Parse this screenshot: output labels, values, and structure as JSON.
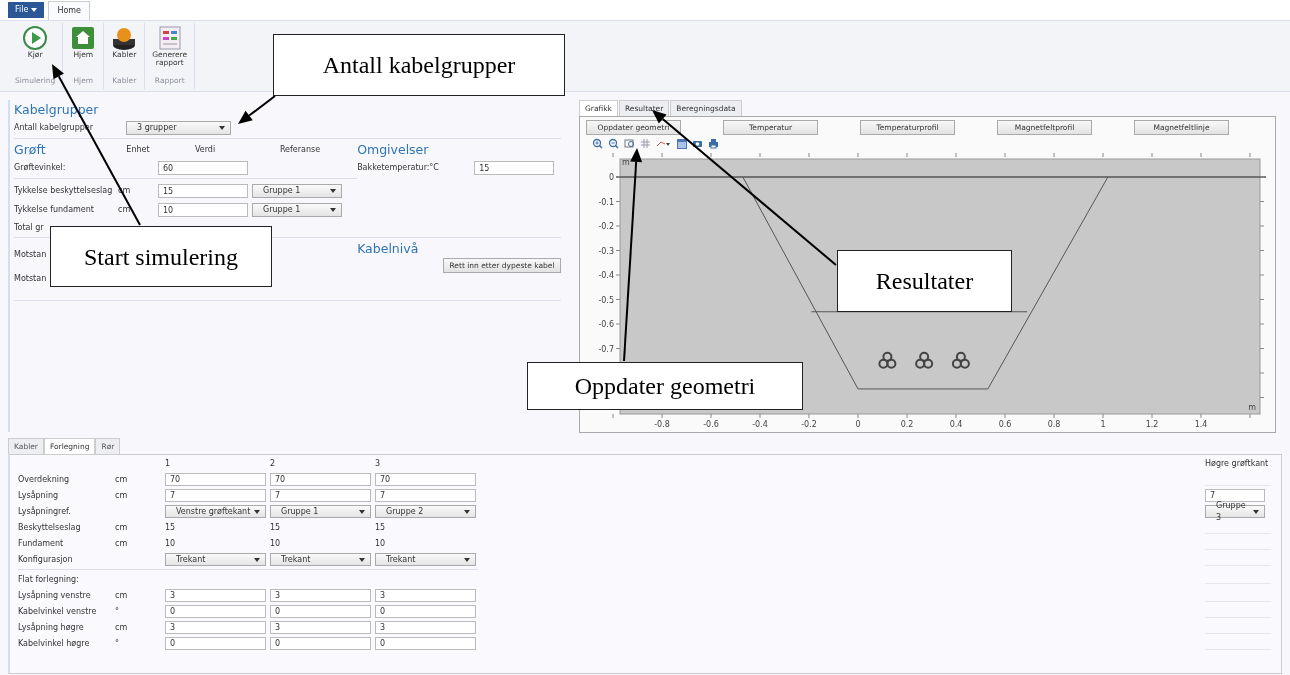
{
  "ribbon": {
    "file_menu": "File",
    "tabs": [
      {
        "label": "Home",
        "selected": true
      }
    ],
    "groups": [
      {
        "label": "Simulering",
        "buttons": [
          {
            "label": "Kjør",
            "kind": "play"
          }
        ]
      },
      {
        "label": "Hjem",
        "buttons": [
          {
            "label": "Hjem",
            "kind": "home"
          }
        ]
      },
      {
        "label": "Kabler",
        "buttons": [
          {
            "label": "Kabler",
            "kind": "cable"
          }
        ]
      },
      {
        "label": "Rapport",
        "buttons": [
          {
            "label": "Generere\nrapport",
            "kind": "report"
          }
        ]
      }
    ]
  },
  "kabelgrupper": {
    "title": "Kabelgrupper",
    "label": "Antall kabelgrupper",
    "value": "3 grupper"
  },
  "groft": {
    "title": "Grøft",
    "columns": [
      "Enhet",
      "Verdi",
      "Referanse"
    ],
    "rows": [
      {
        "label": "Grøftevinkel:",
        "value": "60"
      },
      {
        "label": "Tykkelse beskyttelseslag",
        "unit": "cm",
        "value": "15",
        "reference": "Gruppe 1"
      },
      {
        "label": "Tykkelse fundament",
        "unit": "cm",
        "value": "10",
        "reference": "Gruppe 1"
      },
      {
        "label": "Total gr"
      }
    ]
  },
  "omgivelser": {
    "title": "Omgivelser",
    "rows": [
      {
        "label": "Bakketemperatur:",
        "unit": "°C",
        "value": "15"
      }
    ]
  },
  "motstand": {
    "rows": [
      {
        "label": "Motstan"
      },
      {
        "label": "Motstan"
      }
    ]
  },
  "kabelniva": {
    "title": "Kabelnivå",
    "button": "Rett inn etter dypeste kabel"
  },
  "graphics": {
    "tabs": [
      {
        "label": "Grafikk",
        "selected": true
      },
      {
        "label": "Resultater",
        "selected": false
      },
      {
        "label": "Beregningsdata",
        "selected": false
      }
    ],
    "buttons": [
      "Oppdater geometri",
      "Temperatur",
      "Temperaturprofil",
      "Magnetfeltprofil",
      "Magnetfeltlinje"
    ],
    "y_ticks": [
      "0",
      "-0.1",
      "-0.2",
      "-0.3",
      "-0.4",
      "-0.5",
      "-0.6",
      "-0.7"
    ],
    "x_ticks": [
      "-0.8",
      "-0.6",
      "-0.4",
      "-0.2",
      "0",
      "0.2",
      "0.4",
      "0.6",
      "0.8",
      "1",
      "1.2",
      "1.4"
    ],
    "y_unit": "m",
    "x_unit": "m"
  },
  "forlegning": {
    "tabs": [
      {
        "label": "Kabler",
        "selected": false
      },
      {
        "label": "Forlegning",
        "selected": true
      },
      {
        "label": "Rør",
        "selected": false
      }
    ],
    "columns": [
      "1",
      "2",
      "3"
    ],
    "right_column": "Høgre grøftkant",
    "rows": [
      {
        "kind": "input",
        "label": "Overdekning",
        "unit": "cm",
        "values": [
          "70",
          "70",
          "70"
        ]
      },
      {
        "kind": "input",
        "label": "Lysåpning",
        "unit": "cm",
        "values": [
          "7",
          "7",
          "7"
        ],
        "right": {
          "kind": "input",
          "value": "7"
        }
      },
      {
        "kind": "select",
        "label": "Lysåpningref.",
        "values": [
          "Venstre grøftekant",
          "Gruppe 1",
          "Gruppe 2"
        ],
        "right": {
          "kind": "select",
          "value": "Gruppe 3"
        }
      },
      {
        "kind": "text",
        "label": "Beskyttelseslag",
        "unit": "cm",
        "values": [
          "15",
          "15",
          "15"
        ]
      },
      {
        "kind": "text",
        "label": "Fundament",
        "unit": "cm",
        "values": [
          "10",
          "10",
          "10"
        ]
      },
      {
        "kind": "select",
        "label": "Konfigurasjon",
        "values": [
          "Trekant",
          "Trekant",
          "Trekant"
        ]
      },
      {
        "kind": "section",
        "label": "Flat forlegning:"
      },
      {
        "kind": "input",
        "label": "Lysåpning venstre",
        "unit": "cm",
        "values": [
          "3",
          "3",
          "3"
        ]
      },
      {
        "kind": "input",
        "label": "Kabelvinkel venstre",
        "unit": "°",
        "values": [
          "0",
          "0",
          "0"
        ]
      },
      {
        "kind": "input",
        "label": "Lysåpning høgre",
        "unit": "cm",
        "values": [
          "3",
          "3",
          "3"
        ]
      },
      {
        "kind": "input",
        "label": "Kabelvinkel høgre",
        "unit": "°",
        "values": [
          "0",
          "0",
          "0"
        ]
      }
    ]
  },
  "annotations": [
    {
      "text": "Antall kabelgrupper"
    },
    {
      "text": "Start simulering"
    },
    {
      "text": "Resultater"
    },
    {
      "text": "Oppdater geometri"
    }
  ]
}
